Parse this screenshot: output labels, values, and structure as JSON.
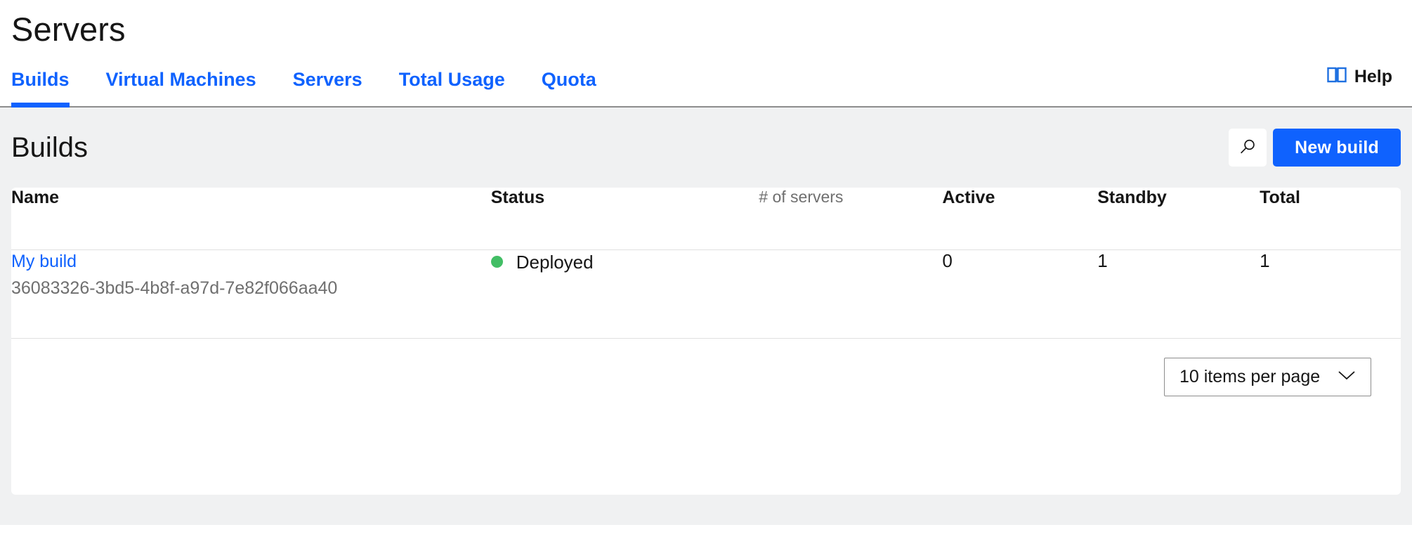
{
  "header": {
    "title": "Servers"
  },
  "tabs": [
    {
      "label": "Builds",
      "active": true
    },
    {
      "label": "Virtual Machines",
      "active": false
    },
    {
      "label": "Servers",
      "active": false
    },
    {
      "label": "Total Usage",
      "active": false
    },
    {
      "label": "Quota",
      "active": false
    }
  ],
  "help": {
    "label": "Help",
    "icon": "book-icon"
  },
  "section": {
    "title": "Builds",
    "search_icon": "search-icon",
    "new_build_label": "New build"
  },
  "table": {
    "columns": {
      "name": "Name",
      "status": "Status",
      "servers_group": "# of servers",
      "active": "Active",
      "standby": "Standby",
      "total": "Total"
    },
    "rows": [
      {
        "name": "My build",
        "uuid": "36083326-3bd5-4b8f-a97d-7e82f066aa40",
        "status": "Deployed",
        "status_color": "#42be65",
        "active": "0",
        "standby": "1",
        "total": "1"
      }
    ]
  },
  "pagination": {
    "page_size_label": "10 items per page",
    "chevron_icon": "chevron-down-icon"
  },
  "colors": {
    "accent": "#0f62fe",
    "page_background": "#f0f1f2",
    "status_green": "#42be65",
    "muted_text": "#6f6f6f"
  }
}
